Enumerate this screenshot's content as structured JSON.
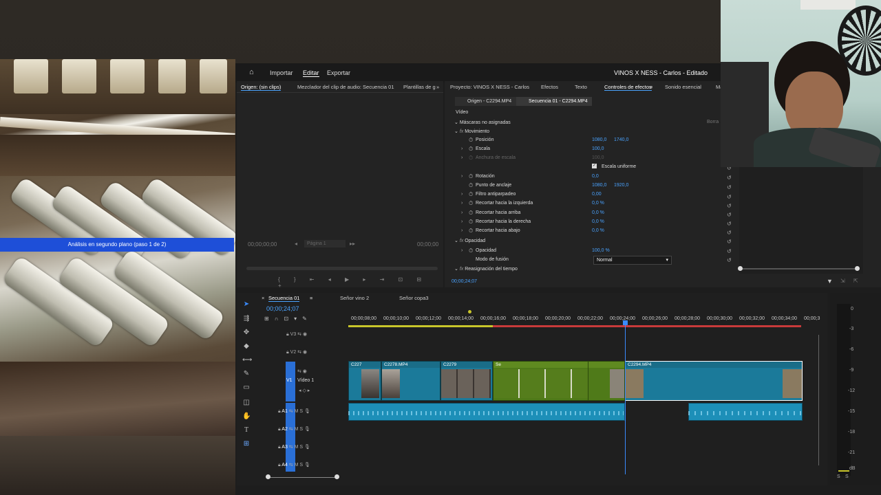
{
  "preview": {
    "background_task": "Análisis en segundo plano (paso 1 de 2)"
  },
  "header": {
    "home_icon": "home-icon",
    "nav": [
      "Importar",
      "Editar",
      "Exportar"
    ],
    "title": "VINOS X NESS - Carlos - Editado"
  },
  "source_monitor": {
    "tabs": [
      "Origen: (sin clips)",
      "Mezclador del clip de audio: Secuencia 01",
      "Plantillas de g"
    ],
    "time_left": "00;00;00;00",
    "page": "Página 1",
    "time_right": "00;00;00"
  },
  "effects_panel": {
    "tabs": [
      "Proyecto: VINOS X NESS - Carlos",
      "Efectos",
      "Texto",
      "Controles de efectos",
      "Sonido esencial",
      "Mar"
    ],
    "clip_tabs": [
      "Origen - C2294.MP4",
      "Secuencia 01 - C2294.MP4"
    ],
    "video_label": "Vídeo",
    "masks": "Máscaras no asignadas",
    "masks_right": "Borra",
    "motion": "Movimiento",
    "rows": [
      {
        "label": "Posición",
        "v1": "1080,0",
        "v2": "1740,0"
      },
      {
        "label": "Escala",
        "v1": "100,0",
        "v2": ""
      },
      {
        "label": "Anchura de escala",
        "v1": "100,0",
        "v2": ""
      },
      {
        "label": "Escala uniforme",
        "v1": "",
        "v2": ""
      },
      {
        "label": "Rotación",
        "v1": "0,0",
        "v2": ""
      },
      {
        "label": "Punto de anclaje",
        "v1": "1080,0",
        "v2": "1920,0"
      },
      {
        "label": "Filtro antiparpadeo",
        "v1": "0,00",
        "v2": ""
      },
      {
        "label": "Recortar hacia la izquierda",
        "v1": "0,0 %",
        "v2": ""
      },
      {
        "label": "Recortar hacia arriba",
        "v1": "0,0 %",
        "v2": ""
      },
      {
        "label": "Recortar hacia la derecha",
        "v1": "0,0 %",
        "v2": ""
      },
      {
        "label": "Recortar hacia abajo",
        "v1": "0,0 %",
        "v2": ""
      }
    ],
    "opacity_section": "Opacidad",
    "opacity_label": "Opacidad",
    "opacity_value": "100,0 %",
    "blend_label": "Modo de fusión",
    "blend_value": "Normal",
    "time_remap": "Reasignación del tiempo",
    "timecode": "00;00;24;07"
  },
  "timeline": {
    "tabs": [
      "Secuencia 01",
      "Señor vino 2",
      "Señor copa3"
    ],
    "timecode": "00;00;24;07",
    "ruler": [
      "00;00;08;00",
      "00;00;10;00",
      "00;00;12;00",
      "00;00;14;00",
      "00;00;16;00",
      "00;00;18;00",
      "00;00;20;00",
      "00;00;22;00",
      "00;00;24;00",
      "00;00;26;00",
      "00;00;28;00",
      "00;00;30;00",
      "00;00;32;00",
      "00;00;34;00",
      "00;00;3"
    ],
    "video_tracks": [
      "V3",
      "V2",
      "V1"
    ],
    "video1_name": "Vídeo 1",
    "audio_tracks": [
      "A1",
      "A2",
      "A3",
      "A4"
    ],
    "clips": [
      "C227",
      "C2278.MP4",
      "C2279",
      "Se",
      "C2294.MP4"
    ],
    "meter_scale": [
      "0",
      "-3",
      "-6",
      "-9",
      "-12",
      "-15",
      "-18",
      "-21",
      "dB"
    ],
    "meter_bottom": [
      "S",
      "S"
    ]
  }
}
